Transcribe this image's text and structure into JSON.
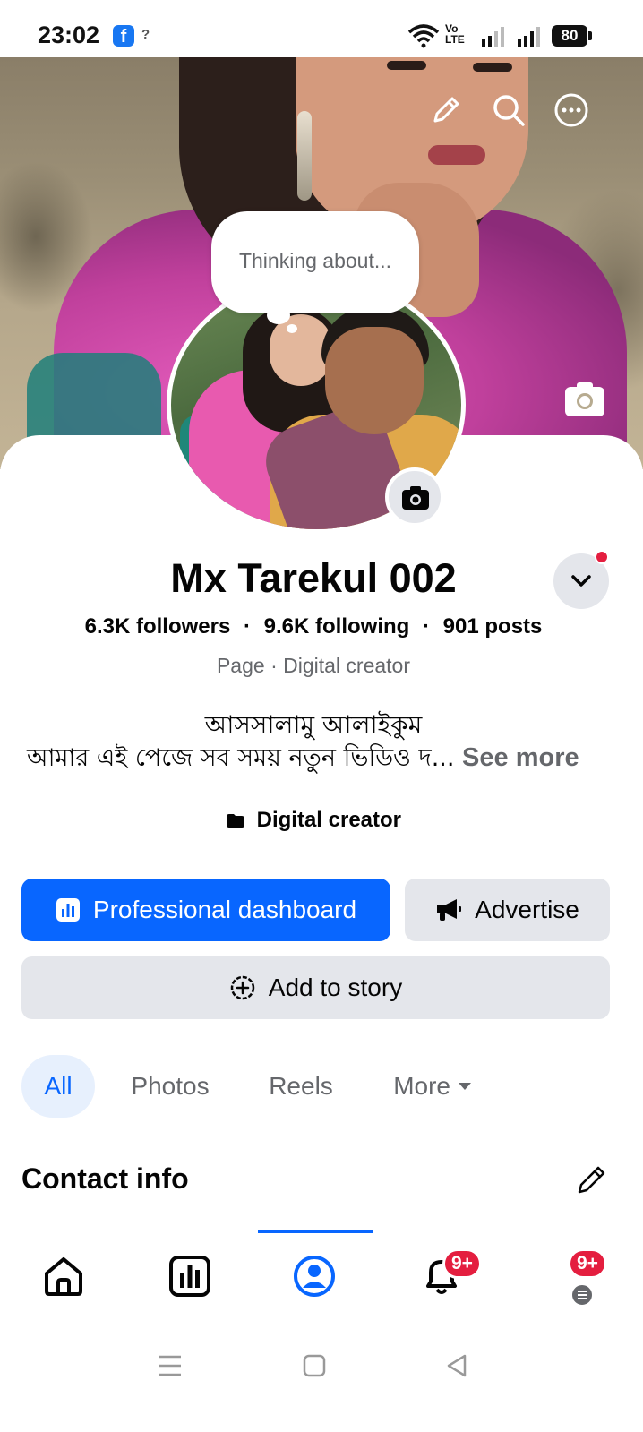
{
  "status_bar": {
    "time": "23:02",
    "signal_extra": "?",
    "volte": "Vo\nLTE",
    "battery": "80"
  },
  "cover": {
    "edit_icon": "pencil-icon",
    "search_icon": "search-icon",
    "more_icon": "more-horizontal-icon",
    "camera_icon": "camera-icon"
  },
  "profile": {
    "thought_bubble": "Thinking about...",
    "name": "Mx Tarekul 002",
    "followers": "6.3K followers",
    "following": "9.6K following",
    "posts": "901 posts",
    "separator": "·",
    "category": "Page · Digital creator",
    "bio_line1": "আসসালামু আলাইকুম",
    "bio_line2": "আমার এই পেজে সব সময় নতুন ভিডিও দ...",
    "see_more": "See more",
    "creator_label": "Digital creator"
  },
  "actions": {
    "professional_dashboard": "Professional dashboard",
    "advertise": "Advertise",
    "add_to_story": "Add to story"
  },
  "filters": {
    "all": "All",
    "photos": "Photos",
    "reels": "Reels",
    "more": "More"
  },
  "contact": {
    "title": "Contact info"
  },
  "bottom_nav": {
    "notifications_badge": "9+",
    "menu_badge": "9+"
  },
  "colors": {
    "accent": "#0866ff",
    "badge": "#e41e3f",
    "chip_bg": "#e4e6eb",
    "secondary_text": "#65676b"
  }
}
